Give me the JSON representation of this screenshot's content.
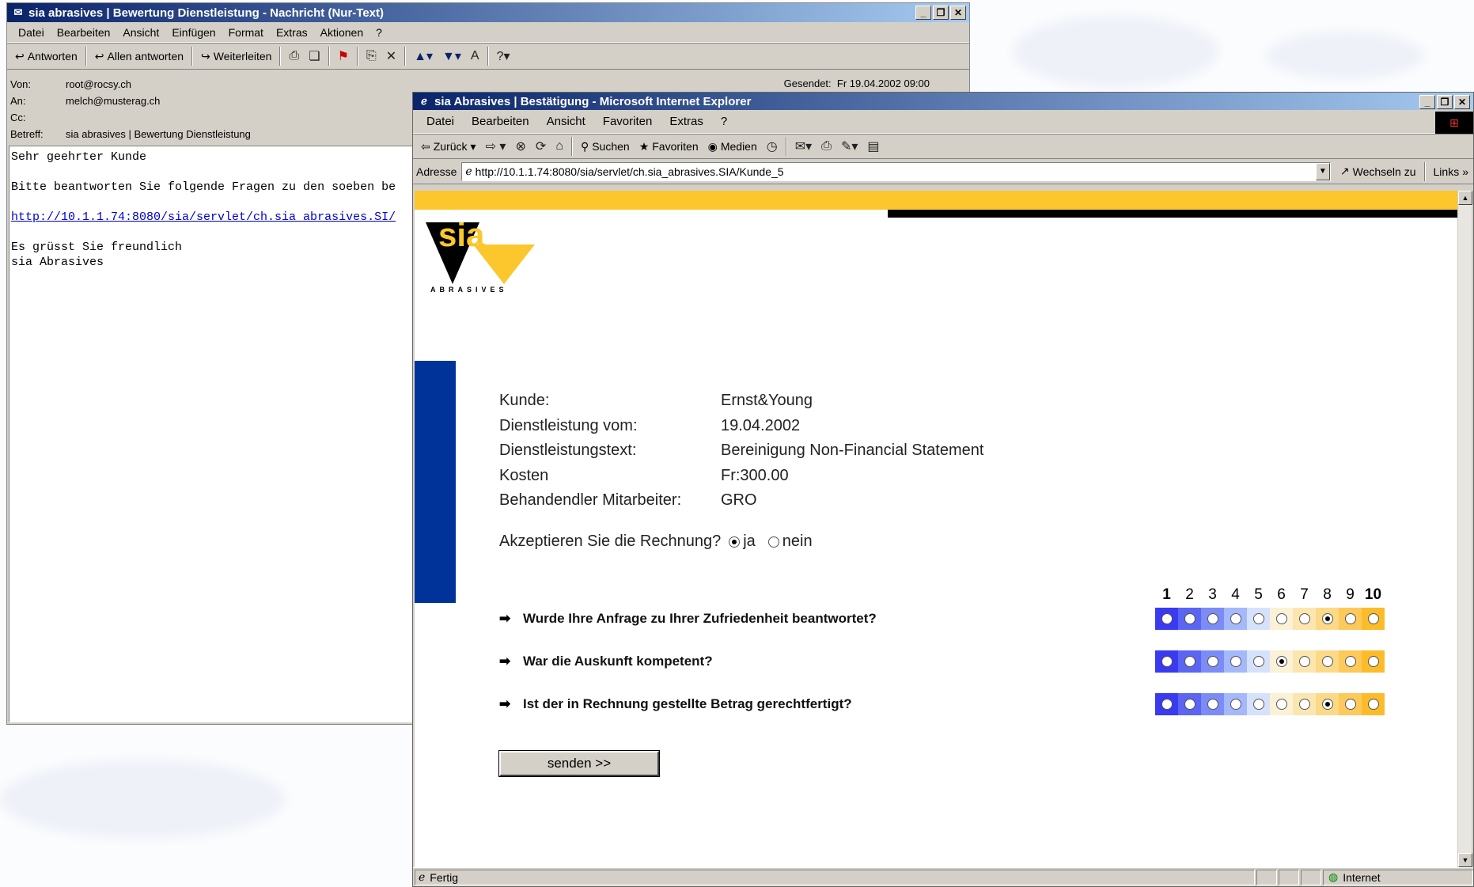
{
  "outlook": {
    "title": "sia abrasives | Bewertung Dienstleistung - Nachricht (Nur-Text)",
    "menu": [
      "Datei",
      "Bearbeiten",
      "Ansicht",
      "Einfügen",
      "Format",
      "Extras",
      "Aktionen",
      "?"
    ],
    "toolbar": {
      "reply": "Antworten",
      "reply_all": "Allen antworten",
      "forward": "Weiterleiten"
    },
    "headers": {
      "from_label": "Von:",
      "from": "root@rocsy.ch",
      "to_label": "An:",
      "to": "melch@musterag.ch",
      "cc_label": "Cc:",
      "cc": "",
      "subject_label": "Betreff:",
      "subject": "sia abrasives | Bewertung Dienstleistung",
      "sent_label": "Gesendet:",
      "sent": "Fr 19.04.2002 09:00"
    },
    "body": {
      "greeting": "Sehr geehrter Kunde",
      "line1": "Bitte beantworten Sie folgende Fragen zu den soeben be",
      "link": "http://10.1.1.74:8080/sia/servlet/ch.sia abrasives.SI/",
      "closing1": "Es grüsst Sie freundlich",
      "closing2": "sia Abrasives"
    }
  },
  "ie": {
    "title": "sia Abrasives | Bestätigung - Microsoft Internet Explorer",
    "menu": [
      "Datei",
      "Bearbeiten",
      "Ansicht",
      "Favoriten",
      "Extras",
      "?"
    ],
    "toolbar": {
      "back": "Zurück",
      "search": "Suchen",
      "favorites": "Favoriten",
      "media": "Medien"
    },
    "address_label": "Adresse",
    "address": "http://10.1.1.74:8080/sia/servlet/ch.sia_abrasives.SIA/Kunde_5",
    "go": "Wechseln zu",
    "links": "Links",
    "status": "Fertig",
    "zone": "Internet"
  },
  "page": {
    "logo_text": "sia",
    "logo_sub": "ABRASIVES",
    "info": [
      {
        "label": "Kunde:",
        "value": "Ernst&Young"
      },
      {
        "label": "Dienstleistung vom:",
        "value": "19.04.2002"
      },
      {
        "label": "Dienstleistungstext:",
        "value": "Bereinigung Non-Financial Statement"
      },
      {
        "label": "Kosten",
        "value": "Fr:300.00"
      },
      {
        "label": "Behandendler Mitarbeiter:",
        "value": "GRO"
      }
    ],
    "accept_question": "Akzeptieren Sie die Rechnung?",
    "accept_yes": "ja",
    "accept_no": "nein",
    "accept_selected": "ja",
    "scale": [
      "1",
      "2",
      "3",
      "4",
      "5",
      "6",
      "7",
      "8",
      "9",
      "10"
    ],
    "questions": [
      {
        "text": "Wurde Ihre Anfrage zu Ihrer Zufriedenheit beantwortet?",
        "selected": 8
      },
      {
        "text": "War die Auskunft kompetent?",
        "selected": 6
      },
      {
        "text": "Ist der in Rechnung gestellte Betrag gerechtfertigt?",
        "selected": 8
      }
    ],
    "scale_colors": [
      "#3a3af0",
      "#5c64f2",
      "#7c8cf6",
      "#a4b8fa",
      "#d6e2fc",
      "#fbf1d6",
      "#fce6b0",
      "#fcd987",
      "#fcc95a",
      "#fcbc2a"
    ],
    "send_label": "senden >>"
  }
}
